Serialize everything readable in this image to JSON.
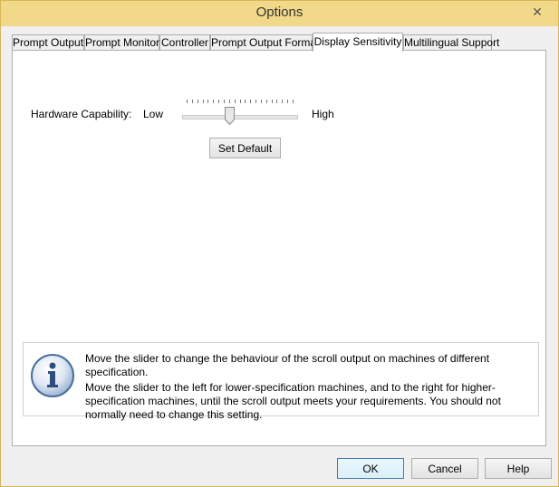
{
  "window": {
    "title": "Options",
    "close_glyph": "✕"
  },
  "tabs": [
    {
      "label": "Prompt Output",
      "active": false
    },
    {
      "label": "Prompt Monitor",
      "active": false
    },
    {
      "label": "Controller",
      "active": false
    },
    {
      "label": "Prompt Output Format",
      "active": false
    },
    {
      "label": "Display Sensitivity",
      "active": true
    },
    {
      "label": "Multilingual Support",
      "active": false
    }
  ],
  "display_sensitivity": {
    "hardware_label": "Hardware Capability:",
    "low_label": "Low",
    "high_label": "High",
    "slider_value_fraction": 0.4,
    "set_default_label": "Set Default"
  },
  "info": {
    "icon": "info-icon",
    "line1": "Move the slider to change the behaviour of the scroll output on machines of different specification.",
    "line2": "Move the slider to the left for lower-specification machines, and to the right for higher-specification machines, until the scroll output meets your requirements. You should not normally need to change this setting."
  },
  "footer": {
    "ok_label": "OK",
    "cancel_label": "Cancel",
    "help_label": "Help"
  }
}
